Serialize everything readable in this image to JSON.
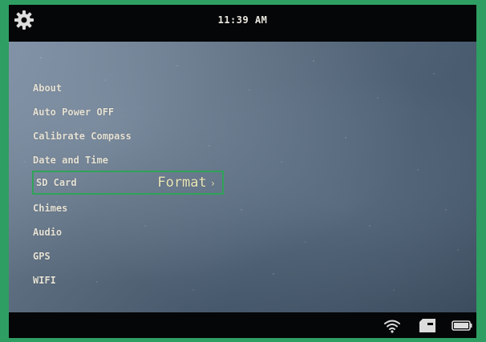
{
  "status_bar": {
    "time": "11:39 AM",
    "settings_icon": "gear-icon"
  },
  "menu": {
    "items": [
      {
        "label": "About"
      },
      {
        "label": "Auto Power OFF"
      },
      {
        "label": "Calibrate Compass"
      },
      {
        "label": "Date and Time"
      },
      {
        "label": "SD Card",
        "action": "Format",
        "action_chevron": "›",
        "selected": true
      },
      {
        "label": "Chimes"
      },
      {
        "label": "Audio"
      },
      {
        "label": "GPS"
      },
      {
        "label": "WIFI"
      }
    ]
  },
  "bottom_bar": {
    "icons": [
      "wifi-icon",
      "sd-card-icon",
      "battery-icon"
    ]
  },
  "colors": {
    "frame": "#2f9e62",
    "highlight_border": "#2fa358",
    "menu_text": "#e6e3d6",
    "action_text": "#ece8b8"
  }
}
